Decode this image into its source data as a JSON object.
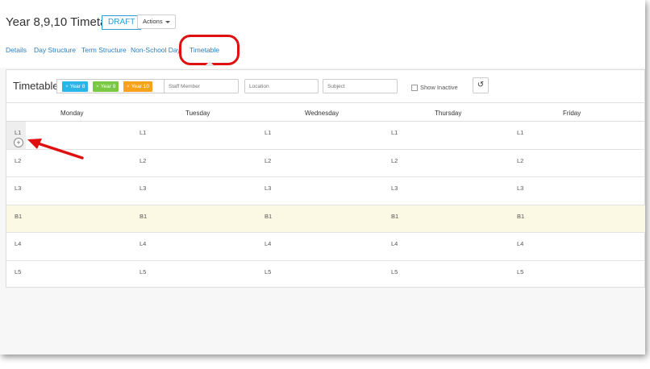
{
  "header": {
    "title": "Year 8,9,10 Timetable",
    "status_badge": "DRAFT",
    "actions_label": "Actions"
  },
  "nav": {
    "tabs": [
      {
        "label": "Details"
      },
      {
        "label": "Day Structure"
      },
      {
        "label": "Term Structure"
      },
      {
        "label": "Non-School Day"
      },
      {
        "label": "Timetable"
      }
    ],
    "active": "Timetable"
  },
  "panel": {
    "title": "Timetable",
    "year_tags": [
      {
        "label": "Year 8",
        "color": "#29b6e8"
      },
      {
        "label": "Year 9",
        "color": "#7ac943"
      },
      {
        "label": "Year 10",
        "color": "#f7a21b"
      }
    ],
    "staff_placeholder": "Staff Member",
    "location_placeholder": "Location",
    "subject_placeholder": "Subject",
    "show_inactive_label": "Show Inactive",
    "reset_icon": "undo-icon"
  },
  "grid": {
    "days": [
      "Monday",
      "Tuesday",
      "Wednesday",
      "Thursday",
      "Friday"
    ],
    "rows": [
      {
        "label": "L1",
        "cells": [
          "L1",
          "L1",
          "L1",
          "L1"
        ]
      },
      {
        "label": "L2",
        "cells": [
          "L2",
          "L2",
          "L2",
          "L2"
        ]
      },
      {
        "label": "L3",
        "cells": [
          "L3",
          "L3",
          "L3",
          "L3"
        ]
      },
      {
        "label": "B1",
        "cells": [
          "B1",
          "B1",
          "B1",
          "B1"
        ]
      },
      {
        "label": "L4",
        "cells": [
          "L4",
          "L4",
          "L4",
          "L4"
        ]
      },
      {
        "label": "L5",
        "cells": [
          "L5",
          "L5",
          "L5",
          "L5"
        ]
      }
    ],
    "break_color": "#fbf8e3"
  },
  "annotation_color": "#e01010"
}
